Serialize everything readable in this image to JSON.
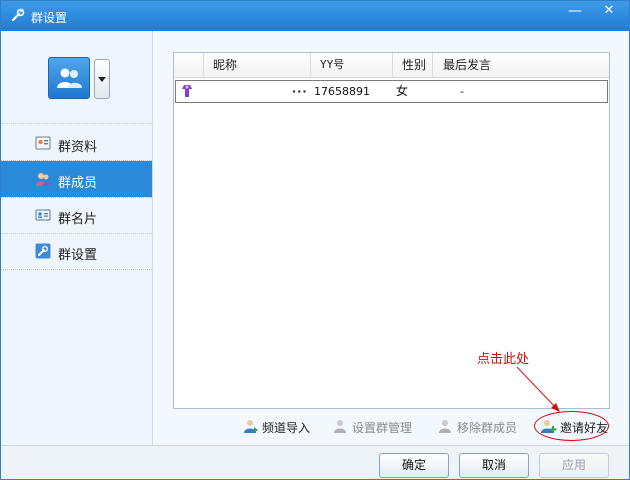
{
  "window": {
    "title": "群设置",
    "minimize_glyph": "—",
    "close_glyph": "✕"
  },
  "sidebar": {
    "avatar_icon": "group-avatar-icon",
    "items": [
      {
        "label": "群资料",
        "icon": "group-info-icon",
        "active": false
      },
      {
        "label": "群成员",
        "icon": "group-members-icon",
        "active": true
      },
      {
        "label": "群名片",
        "icon": "group-card-icon",
        "active": false
      },
      {
        "label": "群设置",
        "icon": "group-settings-icon",
        "active": false
      }
    ]
  },
  "members_table": {
    "columns": [
      "昵称",
      "YY号",
      "性别",
      "最后发言"
    ],
    "rows": [
      {
        "role_icon": "member-role-icon",
        "nickname": "···",
        "yy_id": "17658891",
        "gender": "女",
        "last_speak": "-"
      }
    ]
  },
  "toolbar": {
    "import_label": "频道导入",
    "set_admin_label": "设置群管理",
    "remove_member_label": "移除群成员",
    "invite_friend_label": "邀请好友"
  },
  "annotation": {
    "callout_text": "点击此处",
    "color": "#d01010"
  },
  "footer": {
    "ok_label": "确定",
    "cancel_label": "取消",
    "apply_label": "应用"
  },
  "colors": {
    "titlebar": "#2b8ad9",
    "active_nav": "#2a8ad9",
    "sidebar_bg": "#eef5fc"
  }
}
